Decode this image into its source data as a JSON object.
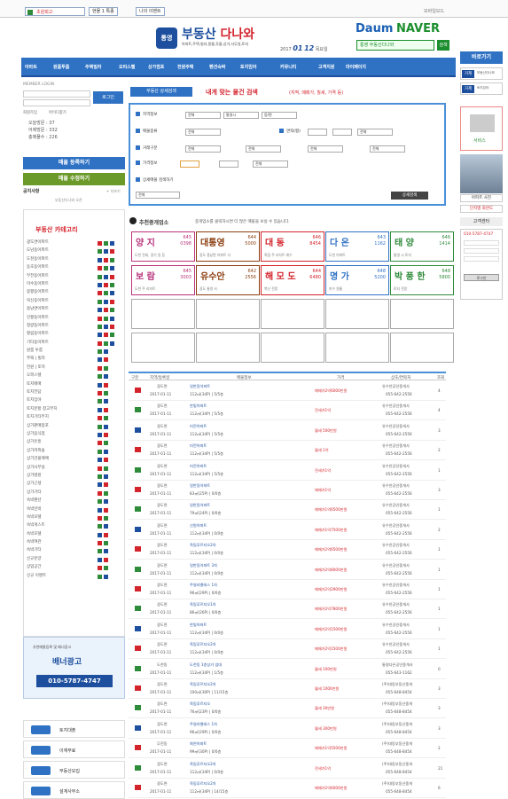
{
  "topbar": {
    "home": "초원회고",
    "btn1": "현물 1 특종",
    "btn2": "나의 이벤트",
    "right": "모바일모드"
  },
  "logo": {
    "badge": "통영",
    "name_blue": "부동산",
    "name_red": "다나와",
    "sub": "아파트,주택,빌라,원룸,투룸,상가,사무실,토지"
  },
  "date": {
    "year": "2017",
    "month": "01",
    "day": "12",
    "weekday": "목요일"
  },
  "partners": {
    "daum": "Daum",
    "naver": "NAVER",
    "search_value": "통영 부동산다나와",
    "search_btn": "검색"
  },
  "nav": [
    "아파트",
    "원룸투룸",
    "주택빌라",
    "오피스텔",
    "상가점포",
    "전원주택",
    "펜션숙박",
    "토지임야",
    "커뮤니티",
    "고객지원",
    "마이페이지"
  ],
  "login": {
    "title": "MEMBER LOGIN",
    "btn": "로그인",
    "register": "회원가입",
    "find": "아이디찾기",
    "stats": [
      "오늘방문 : 37",
      "어제방문 : 332",
      "총매물수 : 226"
    ]
  },
  "actions": {
    "reg": "매물 등록하기",
    "edit": "매물 수정하기",
    "notice": "공지사항",
    "more": "+ 더보기",
    "notice_text": "부동산다나와 오픈"
  },
  "category_title": "부동산 카테고리",
  "categories": [
    "광도면아파트",
    "도남동아파트",
    "도천동아파트",
    "동호동아파트",
    "무전동아파트",
    "미수동아파트",
    "봉평동아파트",
    "북신동아파트",
    "용남면아파트",
    "인평동아파트",
    "정량동아파트",
    "평림동아파트",
    "기타동아파트",
    "원룸 투룸",
    "주택 | 빌라",
    "전원 | 토목",
    "오피스텔",
    "토지매매",
    "토지전답",
    "토지임야",
    "토지분할 창고부지",
    "토지기타부지",
    "상가판매점포",
    "상가음식점",
    "상가유흥",
    "상가커피숍",
    "상가건물매매",
    "상가사무실",
    "상가병원",
    "상가근생",
    "상가기타",
    "숙박펜션",
    "숙박민박",
    "숙박모텔",
    "숙박게스트",
    "숙박호텔",
    "숙박여관",
    "숙박기타",
    "신규분양",
    "상업공간",
    "신규 이벤트"
  ],
  "banner": {
    "title": "추천매물등록 및 배너광고",
    "main": "배너광고",
    "phone": "010-5787-4747"
  },
  "partners_list": [
    "토지대출",
    "이재무료",
    "부동산모집",
    "설계사무소"
  ],
  "search": {
    "tab1": "부동산 상세검색",
    "title": "내게 맞는 물건 검색",
    "hint": "(지역, 매매가, 월세, 가격 등)",
    "rows": [
      "지역정보",
      "매물종류",
      "거래구분",
      "가격정보",
      "상세매물 검색하기"
    ],
    "area": "면적(평)",
    "sel1": "전체",
    "sel2": "통영시",
    "sel3": "동/면",
    "btn": "상세검색"
  },
  "recommend": {
    "title": "추천중개업소",
    "note": "중개업소를 클릭하시면 더 많은 매물을 보실 수 있습니다."
  },
  "agents": [
    {
      "name": "양 지",
      "a": "645",
      "b": "0398",
      "desc": "도천 전세, 경기 일 등",
      "color": "#b8327b"
    },
    {
      "name": "대통영",
      "a": "644",
      "b": "5000",
      "desc": "광도 용남면 아파트 사",
      "color": "#8a3d0e"
    },
    {
      "name": "대 동",
      "a": "646",
      "b": "8454",
      "desc": "죽림 주 리자트 재수",
      "color": "#d3232b"
    },
    {
      "name": "다 온",
      "a": "643",
      "b": "1162",
      "desc": "도천 아파트",
      "color": "#2f72c4"
    },
    {
      "name": "태 양",
      "a": "646",
      "b": "1414",
      "desc": "통영 시 토지",
      "color": "#2e8b3a"
    },
    {
      "name": "보 람",
      "a": "645",
      "b": "3003",
      "desc": "도천 주 리자트",
      "color": "#b8327b"
    },
    {
      "name": "유수안",
      "a": "642",
      "b": "2556",
      "desc": "광도 통영 사",
      "color": "#8a3d0e"
    },
    {
      "name": "해 모 도",
      "a": "644",
      "b": "6480",
      "desc": "북신 전망",
      "color": "#d3232b"
    },
    {
      "name": "명 가",
      "a": "648",
      "b": "5200",
      "desc": "미수 원룸",
      "color": "#2f72c4"
    },
    {
      "name": "박 풍 한",
      "a": "648",
      "b": "5800",
      "desc": "토지 전망",
      "color": "#2e8b3a"
    }
  ],
  "table": {
    "headers": [
      "구분",
      "지역/등록일",
      "매물정보",
      "가격",
      "상호/연락처",
      "조회"
    ],
    "rows": [
      {
        "loc": "광도면",
        "date": "2017-01-11",
        "info1": "일반동아파트",
        "info2": "112㎡(34P) | 5/5층",
        "price": "매매가2억6000만원",
        "agent": "유수안공인중개사",
        "tel": "055-642-2556",
        "views": "4"
      },
      {
        "loc": "광도면",
        "date": "2017-01-11",
        "info1": "한빛아파트",
        "info2": "112㎡(34P) | 5/5층",
        "price": "전세가1억",
        "agent": "유수안공인중개사",
        "tel": "055-642-2556",
        "views": "4"
      },
      {
        "loc": "광도면",
        "date": "2017-01-11",
        "info1": "미전아파트",
        "info2": "112㎡(34P) | 5/5층",
        "price": "월세 500만원",
        "agent": "유수안공인중개사",
        "tel": "055-642-2556",
        "views": "3"
      },
      {
        "loc": "광도면",
        "date": "2017-01-11",
        "info1": "미전아파트",
        "info2": "112㎡(34P) | 5/5층",
        "price": "월세 1억",
        "agent": "유수안공인중개사",
        "tel": "055-642-2556",
        "views": "2"
      },
      {
        "loc": "광도면",
        "date": "2017-01-11",
        "info1": "미전아파트",
        "info2": "112㎡(34P) | 5/5층",
        "price": "전세가1억",
        "agent": "유수안공인중개사",
        "tel": "055-642-2556",
        "views": "1"
      },
      {
        "loc": "광도면",
        "date": "2017-01-11",
        "info1": "일반동아파트",
        "info2": "83㎡(25P) | 0/0층",
        "price": "매매가1억",
        "agent": "유수안공인중개사",
        "tel": "055-642-2556",
        "views": "3"
      },
      {
        "loc": "광도면",
        "date": "2017-01-11",
        "info1": "일반동아파트",
        "info2": "79㎡(24P) | 0/0층",
        "price": "매매가1억6500만원",
        "agent": "유수안공인중개사",
        "tel": "055-642-2556",
        "views": "1"
      },
      {
        "loc": "광도면",
        "date": "2017-01-11",
        "info1": "신원아파트",
        "info2": "112㎡(34P) | 0/0층",
        "price": "매매가1억7500만원",
        "agent": "유수안공인중개사",
        "tel": "055-642-2556",
        "views": "2"
      },
      {
        "loc": "광도면",
        "date": "2017-01-11",
        "info1": "죽림푸르지오2차",
        "info2": "112㎡(34P) | 0/0층",
        "price": "매매가2억6500만원",
        "agent": "유수안공인중개사",
        "tel": "055-642-2556",
        "views": "1"
      },
      {
        "loc": "광도면",
        "date": "2017-01-11",
        "info1": "일반동아파트 3차",
        "info2": "112㎡(34P) | 0/0층",
        "price": "매매가2억8000만원",
        "agent": "유수안공인중개사",
        "tel": "055-642-2556",
        "views": "1"
      },
      {
        "loc": "광도면",
        "date": "2017-01-11",
        "info1": "주영라벨레스 1차",
        "info2": "96㎡(29P) | 0/0층",
        "price": "매매가2억2900만원",
        "agent": "유수안공인중개사",
        "tel": "055-642-2556",
        "views": "1"
      },
      {
        "loc": "광도면",
        "date": "2017-01-11",
        "info1": "죽림푸르지오1차",
        "info2": "86㎡(26P) | 0/0층",
        "price": "매매가2억7800만원",
        "agent": "유수안공인중개사",
        "tel": "055-642-2556",
        "views": "1"
      },
      {
        "loc": "광도면",
        "date": "2017-01-11",
        "info1": "한빛아파트",
        "info2": "112㎡(34P) | 0/0층",
        "price": "매매가2억1500만원",
        "agent": "유수안공인중개사",
        "tel": "055-642-2556",
        "views": "1"
      },
      {
        "loc": "광도면",
        "date": "2017-01-11",
        "info1": "죽림푸르지오2차",
        "info2": "112㎡(34P) | 0/0층",
        "price": "매매가2억1500만원",
        "agent": "유수안공인중개사",
        "tel": "055-642-2556",
        "views": "1"
      },
      {
        "loc": "도천동",
        "date": "2017-01-11",
        "info1": "도천동 1층상가 임대",
        "info2": "112㎡(34P) | 1/5층",
        "price": "월세 100만원",
        "agent": "통영다온공인중개사",
        "tel": "055-643-1162",
        "views": "0"
      },
      {
        "loc": "광도면",
        "date": "2017-01-11",
        "info1": "죽림푸르지오2차",
        "info2": "100㎡(30P) | 11/15층",
        "price": "월세 1000만원",
        "agent": "(주)대동부동산중개",
        "tel": "055-648-8454",
        "views": "3"
      },
      {
        "loc": "광도면",
        "date": "2017-01-11",
        "info1": "죽림푸르지오",
        "info2": "76㎡(23P) | 0/0층",
        "price": "월세 30만원",
        "agent": "(주)대동부동산중개",
        "tel": "055-648-8454",
        "views": "3"
      },
      {
        "loc": "광도면",
        "date": "2017-01-11",
        "info1": "주영라벨레스 1차",
        "info2": "96㎡(29P) | 0/0층",
        "price": "월세 300만원",
        "agent": "(주)대동부동산중개",
        "tel": "055-648-8454",
        "views": "3"
      },
      {
        "loc": "무전동",
        "date": "2017-01-11",
        "info1": "최연아파트",
        "info2": "99㎡(30P) | 0/0층",
        "price": "매매가1억5500만원",
        "agent": "(주)대동부동산중개",
        "tel": "055-648-8454",
        "views": "2"
      },
      {
        "loc": "광도면",
        "date": "2017-01-11",
        "info1": "죽림푸르지오2차",
        "info2": "112㎡(34P) | 0/0층",
        "price": "전세가1억",
        "agent": "(주)대동부동산중개",
        "tel": "055-648-8454",
        "views": "21"
      },
      {
        "loc": "광도면",
        "date": "2017-01-11",
        "info1": "죽림푸르지오2차",
        "info2": "112㎡(34P) | 14/15층",
        "price": "매매가2억6000만원",
        "agent": "(주)대동부동산중개",
        "tel": "055-648-8454",
        "views": "6"
      }
    ]
  },
  "right": {
    "quick": "바로가기",
    "item1": "거제",
    "item1_sub": "부동산다나와",
    "item2": "거제",
    "item2_sub": "토지임야",
    "service": "서비스",
    "photo1": "아파트 사진",
    "photo2": "단지별 화면도",
    "center": "고객센터",
    "phone": "010-5787-4747",
    "login_label": "로그인",
    "top": "TOP"
  }
}
